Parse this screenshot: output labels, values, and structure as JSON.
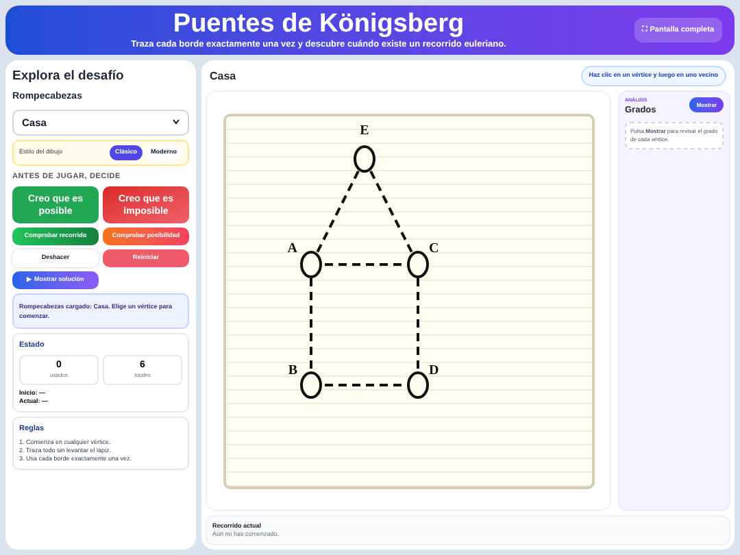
{
  "header": {
    "title": "Puentes de Königsberg",
    "subtitle": "Traza cada borde exactamente una vez y descubre cuándo existe un recorrido euleriano.",
    "fullscreen_button": "⛶ Pantalla completa"
  },
  "sidebar": {
    "title": "Explora el desafío",
    "puzzle_label": "Rompecabezas",
    "puzzle_select": "Casa",
    "style": {
      "label": "Estilo del dibujo",
      "options": [
        {
          "label": "Clásico",
          "selected": true
        },
        {
          "label": "Moderno",
          "selected": false
        }
      ]
    },
    "decide_heading": "ANTES DE JUGAR, DECIDE",
    "buttons": [
      {
        "label": "Creo que es posible",
        "kind": "big-green"
      },
      {
        "label": "Creo que es imposible",
        "kind": "big-red"
      },
      {
        "label": "Comprobar recorrido",
        "kind": "green"
      },
      {
        "label": "Comprobar posibilidad",
        "kind": "orange"
      },
      {
        "label": "Deshacer",
        "kind": "white"
      },
      {
        "label": "Reiniciar",
        "kind": "red"
      },
      {
        "label": "▶ Mostrar solución",
        "kind": "purple"
      }
    ],
    "message": "Rompecabezas cargado: Casa. Elige un vértice para comenzar.",
    "status": {
      "title": "Estado",
      "used": "0",
      "used_label": "usados",
      "total": "6",
      "total_label": "totales",
      "start": "Inicio: —",
      "current": "Actual: —"
    },
    "rules": {
      "title": "Reglas",
      "items": [
        "1. Comienza en cualquier vértice.",
        "2. Traza todo sin levantar el lápiz.",
        "3. Usa cada borde exactamente una vez."
      ]
    }
  },
  "main": {
    "title": "Casa",
    "hint": "Haz clic en un vértice y luego en uno vecino",
    "graph": {
      "vertices": [
        {
          "label": "E"
        },
        {
          "label": "A"
        },
        {
          "label": "C"
        },
        {
          "label": "B"
        },
        {
          "label": "D"
        }
      ]
    },
    "analysis": {
      "eyebrow": "ANÁLISIS",
      "title": "Grados",
      "button": "Mostrar",
      "note": "Pulsa **Mostrar** para revisar el grado de cada vértice."
    },
    "path": {
      "title": "Recorrido actual",
      "text": "Aún no has comenzado."
    }
  }
}
